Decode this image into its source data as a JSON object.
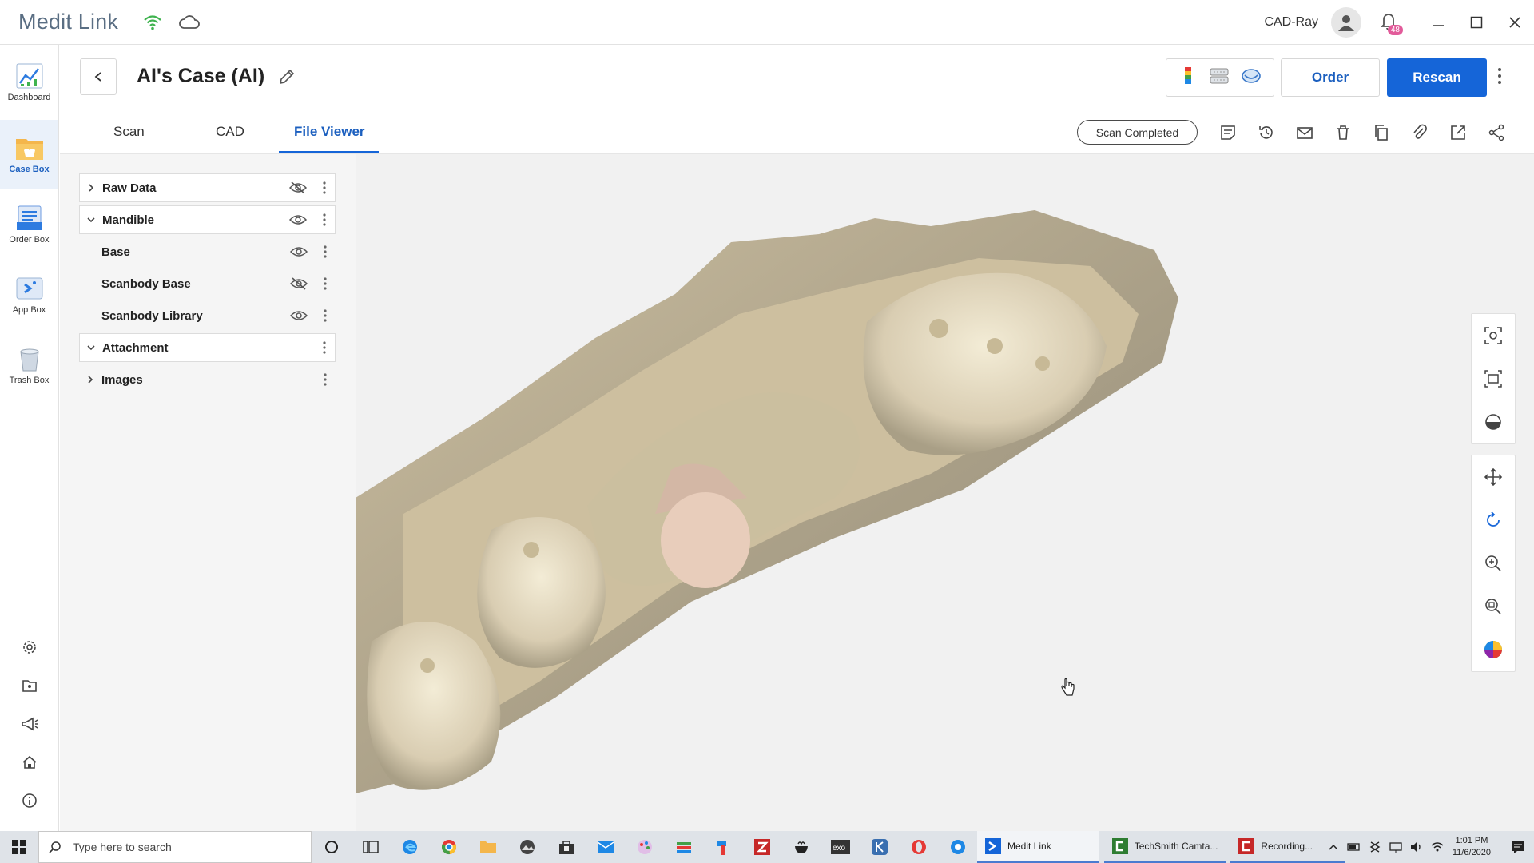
{
  "app": {
    "title": "Medit Link"
  },
  "user": {
    "name": "CAD-Ray",
    "notification_count": "48"
  },
  "rail": {
    "items": [
      {
        "label": "Dashboard"
      },
      {
        "label": "Case Box"
      },
      {
        "label": "Order Box"
      },
      {
        "label": "App Box"
      },
      {
        "label": "Trash Box"
      }
    ]
  },
  "case": {
    "title": "AI's Case (AI)"
  },
  "header": {
    "order_label": "Order",
    "rescan_label": "Rescan"
  },
  "tabs": [
    {
      "label": "Scan"
    },
    {
      "label": "CAD"
    },
    {
      "label": "File Viewer"
    }
  ],
  "status": {
    "label": "Scan Completed"
  },
  "layers": [
    {
      "label": "Raw Data",
      "expanded": false,
      "visible": false
    },
    {
      "label": "Mandible",
      "expanded": true,
      "visible": true
    },
    {
      "label": "Base",
      "visible": true
    },
    {
      "label": "Scanbody Base",
      "visible": false
    },
    {
      "label": "Scanbody Library",
      "visible": true
    },
    {
      "label": "Attachment",
      "expanded": true
    },
    {
      "label": "Images",
      "expanded": false
    }
  ],
  "taskbar": {
    "search_placeholder": "Type here to search",
    "windows": [
      {
        "label": "Medit Link"
      },
      {
        "label": "TechSmith Camta..."
      },
      {
        "label": "Recording..."
      }
    ],
    "time": "1:01 PM",
    "date": "11/6/2020"
  },
  "colors": {
    "accent": "#1565d8",
    "rail_active_bg": "#eaf1fa",
    "model_tone": "#d9cdb2",
    "scanbody": "#e8cdbb"
  }
}
